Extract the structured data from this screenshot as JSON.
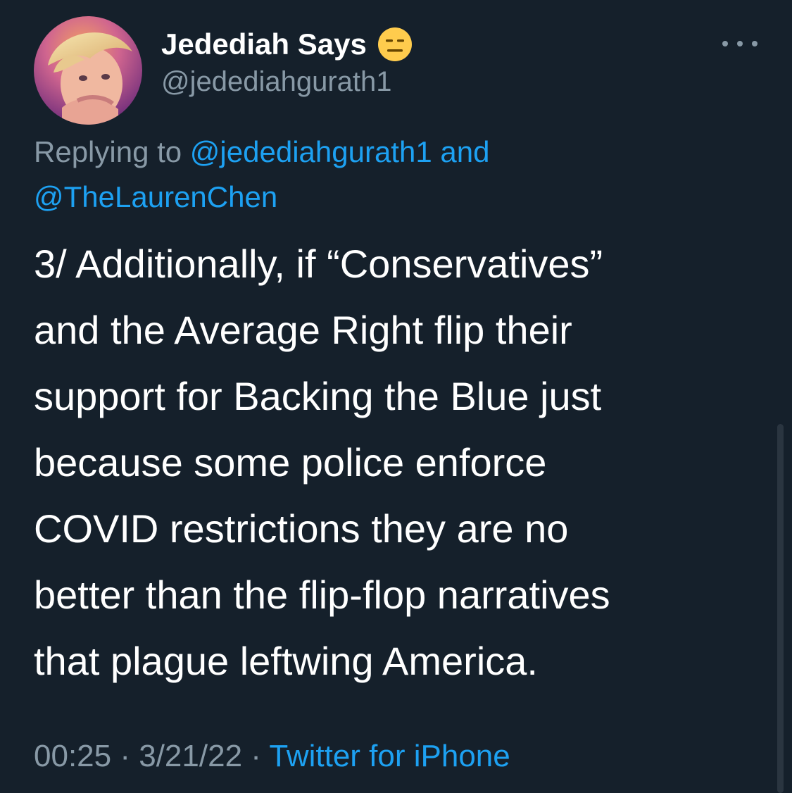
{
  "author": {
    "display_name": "Jedediah Says",
    "emoji": "expressionless-face-emoji",
    "handle": "@jedediahgurath1",
    "avatar": "profile-photo"
  },
  "reply": {
    "prefix": "Replying to",
    "mention_1": "@jedediahgurath1",
    "conjunction": "and",
    "mention_2": "@TheLaurenChen"
  },
  "tweet": {
    "lines": [
      "3/ Additionally, if “Conservatives”",
      "and the Average Right flip their",
      "support for Backing the Blue just",
      "because some police enforce",
      "COVID restrictions they are no",
      "better than the flip-flop narratives",
      "that plague leftwing America."
    ]
  },
  "meta": {
    "time": "00:25",
    "separator": "·",
    "date": "3/21/22",
    "source": "Twitter for iPhone"
  },
  "icons": {
    "more": "more-options-icon"
  },
  "colors": {
    "background": "#15202b",
    "primary_text": "#ffffff",
    "secondary_text": "#8899a6",
    "link": "#1da1f2",
    "emoji_fill": "#ffcc4d"
  }
}
